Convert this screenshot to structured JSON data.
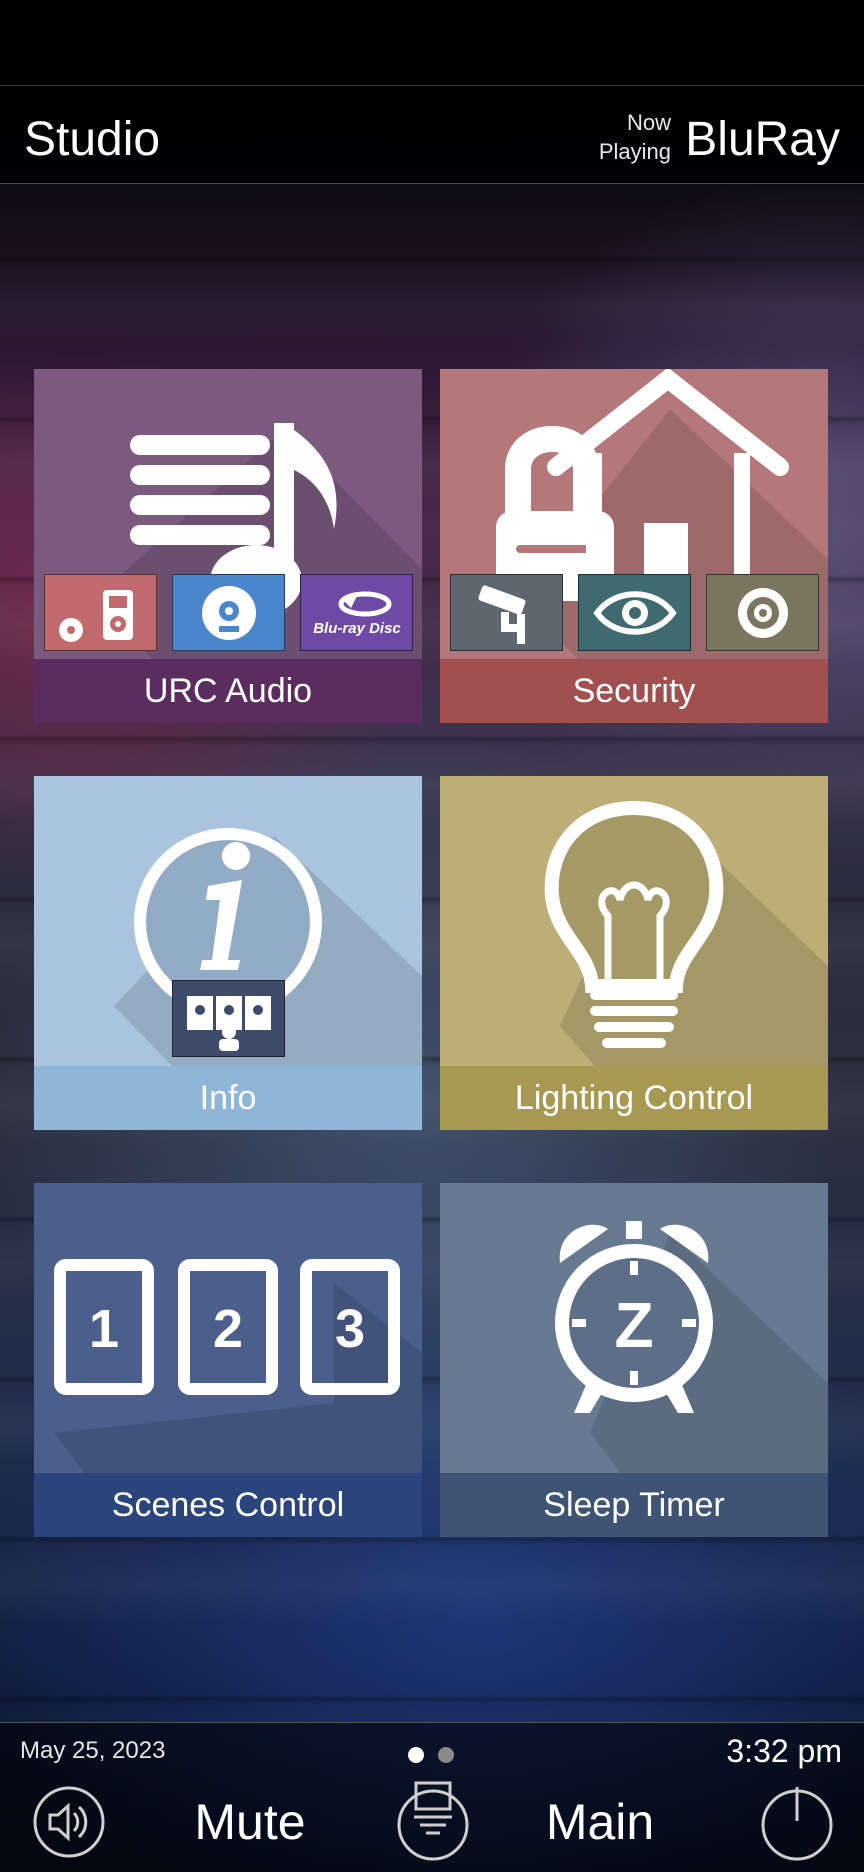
{
  "header": {
    "room": "Studio",
    "now_playing_label_1": "Now",
    "now_playing_label_2": "Playing",
    "source": "BluRay"
  },
  "tiles": [
    {
      "label": "URC Audio",
      "icon": "music-list-icon",
      "color": "#7c5a80",
      "bar_color": "#5a2d5e",
      "sub_buttons": [
        {
          "icon": "ipod-icon",
          "color": "#c06a6e"
        },
        {
          "icon": "cd-icon",
          "color": "#4a86cc"
        },
        {
          "icon": "bluray-disc-icon",
          "color": "#6e4aa6",
          "text": "Blu-ray Disc"
        }
      ]
    },
    {
      "label": "Security",
      "icon": "lock-house-icon",
      "color": "#b4787a",
      "bar_color": "#a24f50",
      "sub_buttons": [
        {
          "icon": "security-camera-icon",
          "color": "#5e6670"
        },
        {
          "icon": "eye-icon",
          "color": "#3e6a70"
        },
        {
          "icon": "gear-icon",
          "color": "#7a7660"
        }
      ]
    },
    {
      "label": "Info",
      "icon": "info-icon",
      "color": "#a9c4dc",
      "bar_color": "#8fb6d6",
      "sub_buttons": [
        {
          "icon": "video-conference-icon",
          "color": "#3e4b6a"
        }
      ]
    },
    {
      "label": "Lighting Control",
      "icon": "light-bulb-icon",
      "color": "#bcae76",
      "bar_color": "#a79852"
    },
    {
      "label": "Scenes Control",
      "icon": "scenes-123-icon",
      "color": "#4b5f8c",
      "bar_color": "#2b447c",
      "scene_numbers": [
        "1",
        "2",
        "3"
      ]
    },
    {
      "label": "Sleep Timer",
      "icon": "alarm-clock-z-icon",
      "color": "#687a92",
      "bar_color": "#3f5474",
      "clock_letter": "Z"
    }
  ],
  "footer": {
    "date": "May 25, 2023",
    "time": "3:32 pm",
    "page_count": 2,
    "active_page": 1,
    "mute_label": "Mute",
    "main_label": "Main",
    "icons": [
      "volume-icon",
      "menu-icon",
      "power-icon"
    ]
  }
}
